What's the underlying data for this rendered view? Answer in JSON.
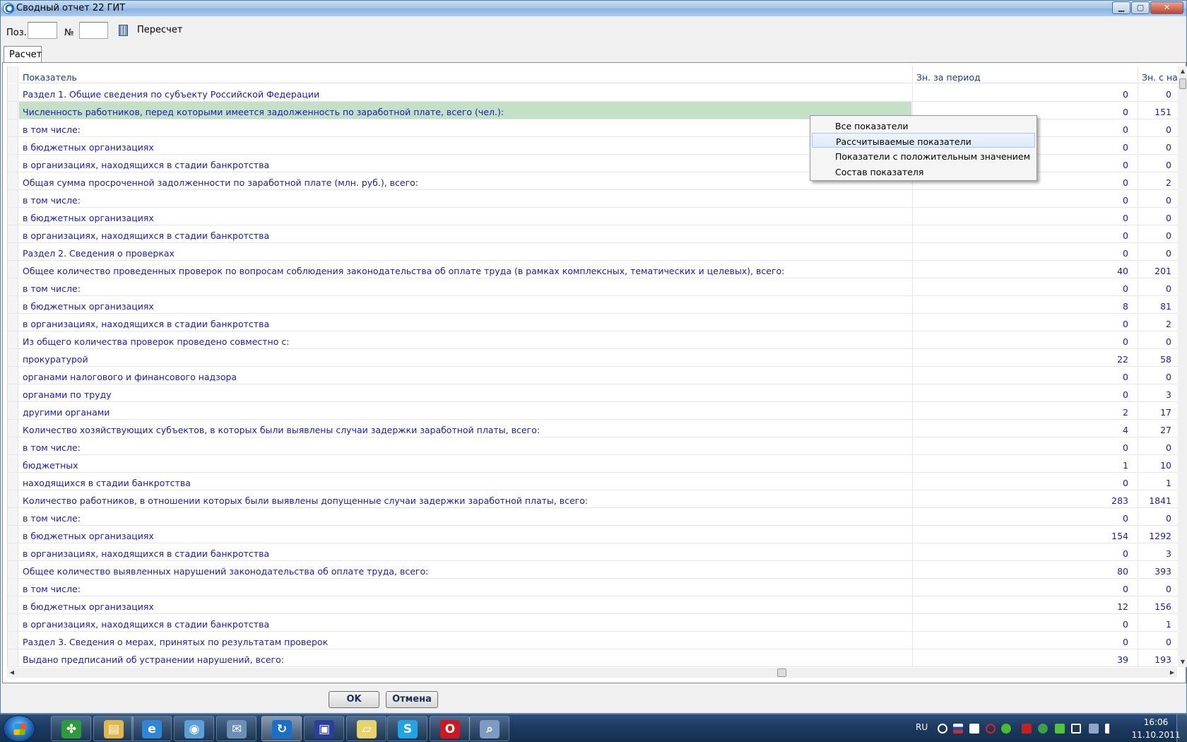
{
  "window": {
    "title": "Сводный отчет 22 ГИТ",
    "min_glyph": "▁",
    "max_glyph": "▢",
    "close_glyph": "✕"
  },
  "toolbar": {
    "pos_label": "Поз.",
    "num_label": "№",
    "pos_value": "",
    "num_value": "",
    "recalc_label": "Пересчет"
  },
  "tabs": [
    {
      "label": "Расчет"
    }
  ],
  "grid": {
    "columns": [
      "Показатель",
      "Зн. за период",
      "Зн. с на"
    ],
    "rows": [
      {
        "name": "Раздел 1. Общие сведения по субъекту Российской Федерации",
        "period": "0",
        "ytd": "0"
      },
      {
        "name": "Численность работников, перед которыми имеется задолженность по заработной плате, всего (чел.):",
        "period": "0",
        "ytd": "151"
      },
      {
        "name": "в том числе:",
        "period": "0",
        "ytd": "0"
      },
      {
        "name": "в бюджетных организациях",
        "period": "0",
        "ytd": "0"
      },
      {
        "name": "в организациях, находящихся в стадии банкротства",
        "period": "0",
        "ytd": "0"
      },
      {
        "name": "Общая сумма просроченной задолженности по заработной плате (млн. руб.), всего:",
        "period": "0",
        "ytd": "2"
      },
      {
        "name": "в том числе:",
        "period": "0",
        "ytd": "0"
      },
      {
        "name": "в бюджетных организациях",
        "period": "0",
        "ytd": "0"
      },
      {
        "name": "в организациях, находящихся в стадии банкротства",
        "period": "0",
        "ytd": "0"
      },
      {
        "name": "Раздел 2. Сведения о проверках",
        "period": "0",
        "ytd": "0"
      },
      {
        "name": "Общее количество проведенных проверок по вопросам соблюдения законодательства об оплате труда (в рамках комплексных, тематических и целевых),  всего:",
        "period": "40",
        "ytd": "201"
      },
      {
        "name": "в том числе:",
        "period": "0",
        "ytd": "0"
      },
      {
        "name": "в бюджетных организациях",
        "period": "8",
        "ytd": "81"
      },
      {
        "name": "в организациях, находящихся в стадии банкротства",
        "period": "0",
        "ytd": "2"
      },
      {
        "name": "Из общего количества проверок проведено совместно с:",
        "period": "0",
        "ytd": "0"
      },
      {
        "name": "прокуратурой",
        "period": "22",
        "ytd": "58"
      },
      {
        "name": "органами налогового и  финансового надзора",
        "period": "0",
        "ytd": "0"
      },
      {
        "name": "органами по труду",
        "period": "0",
        "ytd": "3"
      },
      {
        "name": "другими органами",
        "period": "2",
        "ytd": "17"
      },
      {
        "name": "Количество хозяйствующих субъектов, в которых были выявлены случаи задержки  заработной платы, всего:",
        "period": "4",
        "ytd": "27"
      },
      {
        "name": "в том числе:",
        "period": "0",
        "ytd": "0"
      },
      {
        "name": "бюджетных",
        "period": "1",
        "ytd": "10"
      },
      {
        "name": "находящихся в стадии банкротства",
        "period": "0",
        "ytd": "1"
      },
      {
        "name": "Количество работников, в отношении которых были выявлены допущенные случаи задержки заработной платы, всего:",
        "period": "283",
        "ytd": "1841"
      },
      {
        "name": "в том числе:",
        "period": "0",
        "ytd": "0"
      },
      {
        "name": "в бюджетных организациях",
        "period": "154",
        "ytd": "1292"
      },
      {
        "name": "в организациях, находящихся в стадии банкротства",
        "period": "0",
        "ytd": "3"
      },
      {
        "name": "Общее количество выявленных нарушений законодательства об оплате труда, всего:",
        "period": "80",
        "ytd": "393"
      },
      {
        "name": "в том числе:",
        "period": "0",
        "ytd": "0"
      },
      {
        "name": "в бюджетных организациях",
        "period": "12",
        "ytd": "156"
      },
      {
        "name": "в организациях, находящихся в стадии банкротства",
        "period": "0",
        "ytd": "1"
      },
      {
        "name": "Раздел 3. Сведения о мерах, принятых по результатам проверок",
        "period": "0",
        "ytd": "0"
      },
      {
        "name": "Выдано предписаний об устранении нарушений, всего:",
        "period": "39",
        "ytd": "193"
      }
    ],
    "highlight_row": 1,
    "highlight_color": "#c4e0c7",
    "text_color": "#1a1ab8"
  },
  "context_menu": {
    "items": [
      {
        "label": "Все показатели"
      },
      {
        "label": "Рассчитываемые показатели"
      },
      {
        "label": "Показатели с положительным значением"
      },
      {
        "label": "Состав показателя"
      }
    ],
    "hovered": 1
  },
  "footer": {
    "ok_label": "OK",
    "cancel_label": "Отмена"
  },
  "taskbar": {
    "apps": [
      {
        "icon": "clover-icon",
        "glyph": "✤",
        "color": "#2e9a3a"
      },
      {
        "icon": "folder-icon",
        "glyph": "▤",
        "color": "#e0b84a"
      },
      {
        "icon": "internet-explorer-icon",
        "glyph": "e",
        "color": "#2f86d6"
      },
      {
        "icon": "globe-app-icon",
        "glyph": "◉",
        "color": "#5aa0d8"
      },
      {
        "icon": "mail-app-icon",
        "glyph": "✉",
        "color": "#6b8fb5"
      },
      {
        "icon": "report-app-icon",
        "glyph": "↻",
        "color": "#1a6fc7"
      },
      {
        "icon": "floppy-save-icon",
        "glyph": "▣",
        "color": "#2a3f9c"
      },
      {
        "icon": "sticky-notes-icon",
        "glyph": "▱",
        "color": "#e7d36a"
      },
      {
        "icon": "skype-icon",
        "glyph": "S",
        "color": "#1ea5e6"
      },
      {
        "icon": "opera-icon",
        "glyph": "O",
        "color": "#d2161e"
      },
      {
        "icon": "search-magnifier-icon",
        "glyph": "⌕",
        "color": "#7c9bbf"
      }
    ],
    "active_app": 5,
    "lang": "RU",
    "time": "16:06",
    "date": "11.10.2011"
  }
}
